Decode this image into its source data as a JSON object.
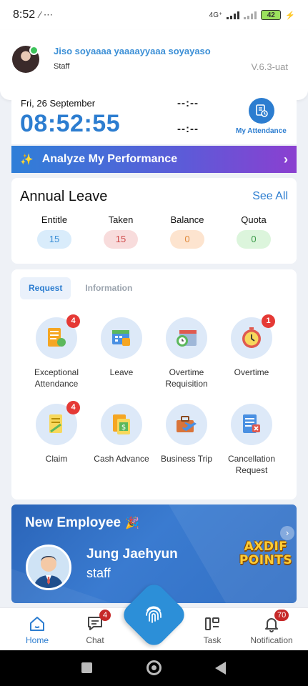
{
  "status_bar": {
    "time": "8:52",
    "icons": "∕ ⋯",
    "network": "4G⁺",
    "battery": "42"
  },
  "header": {
    "user_name": "Jiso soyaaaa yaaaayyaaa soyayaso",
    "user_role": "Staff",
    "version": "V.6.3-uat"
  },
  "time_card": {
    "date": "Fri, 26 September",
    "clock": "08:52:55",
    "clock_in": "--:--",
    "clock_out": "--:--",
    "attendance_label": "My Attendance"
  },
  "analyze": {
    "label": "Analyze My Performance"
  },
  "annual_leave": {
    "title": "Annual Leave",
    "see_all": "See All",
    "columns": [
      {
        "label": "Entitle",
        "value": "15",
        "bg": "#d9ecfb",
        "fg": "#3b8fd6"
      },
      {
        "label": "Taken",
        "value": "15",
        "bg": "#f8dcdc",
        "fg": "#d04b4b"
      },
      {
        "label": "Balance",
        "value": "0",
        "bg": "#fde4cf",
        "fg": "#e08a3c"
      },
      {
        "label": "Quota",
        "value": "0",
        "bg": "#dcf5dc",
        "fg": "#3c9b4a"
      }
    ]
  },
  "tabs": [
    {
      "label": "Request"
    },
    {
      "label": "Information"
    }
  ],
  "menu_items": [
    {
      "label": "Exceptional Attendance",
      "icon": "exceptional-attendance-icon",
      "badge": "4"
    },
    {
      "label": "Leave",
      "icon": "leave-icon",
      "badge": ""
    },
    {
      "label": "Overtime Requisition",
      "icon": "overtime-requisition-icon",
      "badge": ""
    },
    {
      "label": "Overtime",
      "icon": "overtime-icon",
      "badge": "1"
    },
    {
      "label": "Claim",
      "icon": "claim-icon",
      "badge": "4"
    },
    {
      "label": "Cash Advance",
      "icon": "cash-advance-icon",
      "badge": ""
    },
    {
      "label": "Business Trip",
      "icon": "business-trip-icon",
      "badge": ""
    },
    {
      "label": "Cancellation Request",
      "icon": "cancellation-request-icon",
      "badge": ""
    }
  ],
  "new_employee": {
    "title": "New Employee",
    "party": "🎉",
    "name": "Jung Jaehyun",
    "role": "staff",
    "points_line1": "AXDIF",
    "points_line2": "POINTS"
  },
  "bottom_nav": {
    "home": "Home",
    "chat": "Chat",
    "chat_badge": "4",
    "task": "Task",
    "notification": "Notification",
    "notification_badge": "70"
  },
  "colors": {
    "accent": "#2c7dd0",
    "badge": "#e53935"
  }
}
